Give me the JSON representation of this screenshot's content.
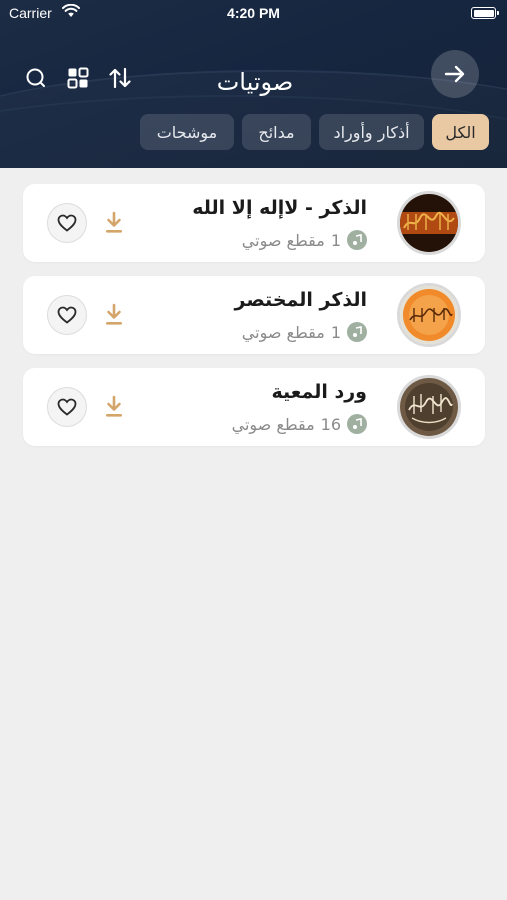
{
  "status_bar": {
    "carrier": "Carrier",
    "time": "4:20 PM"
  },
  "header": {
    "title": "صوتيات",
    "icons": [
      "search-icon",
      "grid-view-icon",
      "sort-icon",
      "back-arrow-icon"
    ]
  },
  "tabs": [
    {
      "label": "الكل",
      "active": true
    },
    {
      "label": "أذكار وأوراد",
      "active": false
    },
    {
      "label": "مدائح",
      "active": false
    },
    {
      "label": "موشحات",
      "active": false
    }
  ],
  "items": [
    {
      "title": "الذكر - لاإله إلا الله",
      "count": "1",
      "count_label": "مقطع صوتي"
    },
    {
      "title": "الذكر المختصر",
      "count": "1",
      "count_label": "مقطع صوتي"
    },
    {
      "title": "ورد المعية",
      "count": "16",
      "count_label": "مقطع صوتي"
    }
  ],
  "colors": {
    "header_bg": "#172640",
    "accent": "#e8c9a4",
    "download": "#d4a56a",
    "background": "#efefef"
  }
}
